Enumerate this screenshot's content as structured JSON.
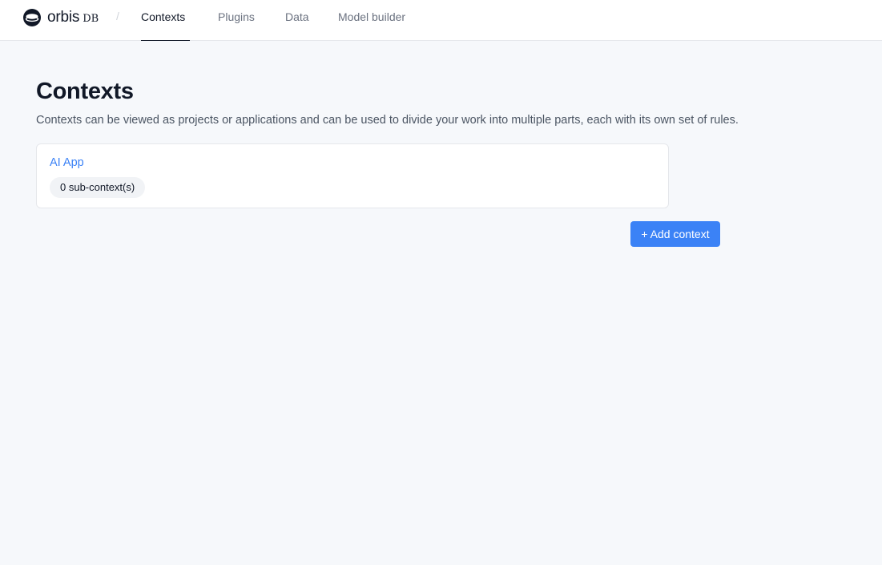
{
  "header": {
    "brand": {
      "name": "orbis",
      "suffix": "DB",
      "icon": "orbis-logo-icon"
    },
    "separator": "/",
    "tabs": [
      {
        "label": "Contexts",
        "active": true
      },
      {
        "label": "Plugins",
        "active": false
      },
      {
        "label": "Data",
        "active": false
      },
      {
        "label": "Model builder",
        "active": false
      }
    ]
  },
  "main": {
    "title": "Contexts",
    "description": "Contexts can be viewed as projects or applications and can be used to divide your work into multiple parts, each with its own set of rules.",
    "contexts": [
      {
        "name": "AI App",
        "sub_contexts": "0 sub-context(s)"
      }
    ],
    "add_button_label": "+ Add context"
  },
  "colors": {
    "accent": "#3b82f6",
    "background": "#f6f8fb",
    "text": "#111827",
    "muted_text": "#6b7280"
  }
}
